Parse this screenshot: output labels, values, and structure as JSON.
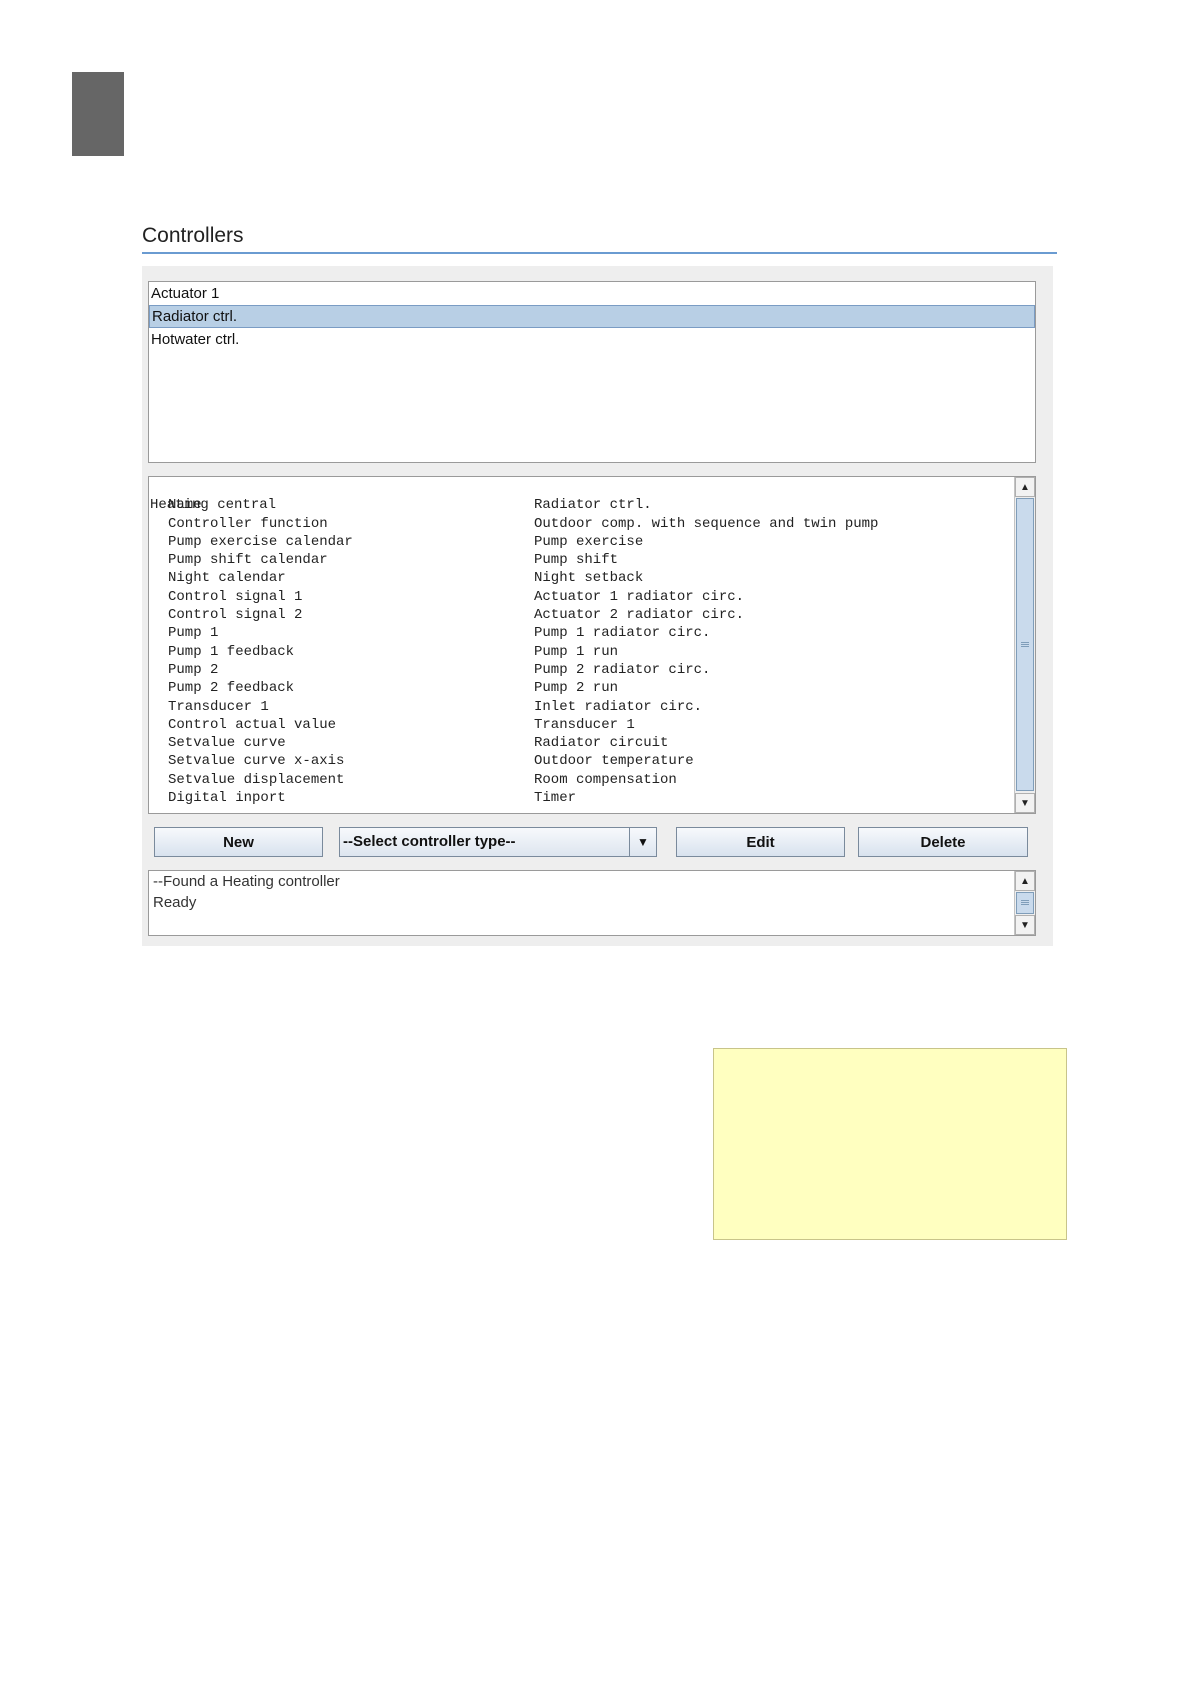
{
  "section": {
    "title": "Controllers"
  },
  "controllers_list": {
    "items": [
      {
        "label": "Actuator 1",
        "selected": false
      },
      {
        "label": "Radiator ctrl.",
        "selected": true
      },
      {
        "label": "Hotwater ctrl.",
        "selected": false
      }
    ]
  },
  "details": {
    "header": "Heating central",
    "rows": [
      {
        "key": "Name",
        "value": "Radiator ctrl."
      },
      {
        "key": "Controller function",
        "value": "Outdoor comp. with sequence and twin pump"
      },
      {
        "key": "Pump exercise calendar",
        "value": "Pump exercise"
      },
      {
        "key": "Pump shift calendar",
        "value": "Pump shift"
      },
      {
        "key": "Night calendar",
        "value": "Night setback"
      },
      {
        "key": "Control signal 1",
        "value": "Actuator 1 radiator circ."
      },
      {
        "key": "Control signal 2",
        "value": "Actuator 2 radiator circ."
      },
      {
        "key": "Pump 1",
        "value": "Pump 1 radiator circ."
      },
      {
        "key": "Pump 1 feedback",
        "value": "Pump 1 run"
      },
      {
        "key": "Pump 2",
        "value": "Pump 2 radiator circ."
      },
      {
        "key": "Pump 2 feedback",
        "value": "Pump 2 run"
      },
      {
        "key": "Transducer 1",
        "value": "Inlet radiator circ."
      },
      {
        "key": "Control actual value",
        "value": "Transducer 1"
      },
      {
        "key": "Setvalue curve",
        "value": "Radiator circuit"
      },
      {
        "key": "Setvalue curve x-axis",
        "value": "Outdoor temperature"
      },
      {
        "key": "Setvalue displacement",
        "value": "Room compensation"
      },
      {
        "key": "Digital inport",
        "value": "Timer"
      }
    ]
  },
  "toolbar": {
    "new_label": "New",
    "controller_type_selected": "--Select controller type--",
    "edit_label": "Edit",
    "delete_label": "Delete"
  },
  "status_log": {
    "lines": [
      "--Found a Heating controller",
      "Ready"
    ]
  },
  "icons": {
    "scroll_up": "arrow-up-icon",
    "scroll_down": "arrow-down-icon",
    "dropdown": "chevron-down-icon"
  },
  "colors": {
    "accent_rule": "#6a9bd1",
    "selection": "#b8cfe5",
    "note_background": "#ffffc0",
    "page_tab": "#666666"
  }
}
